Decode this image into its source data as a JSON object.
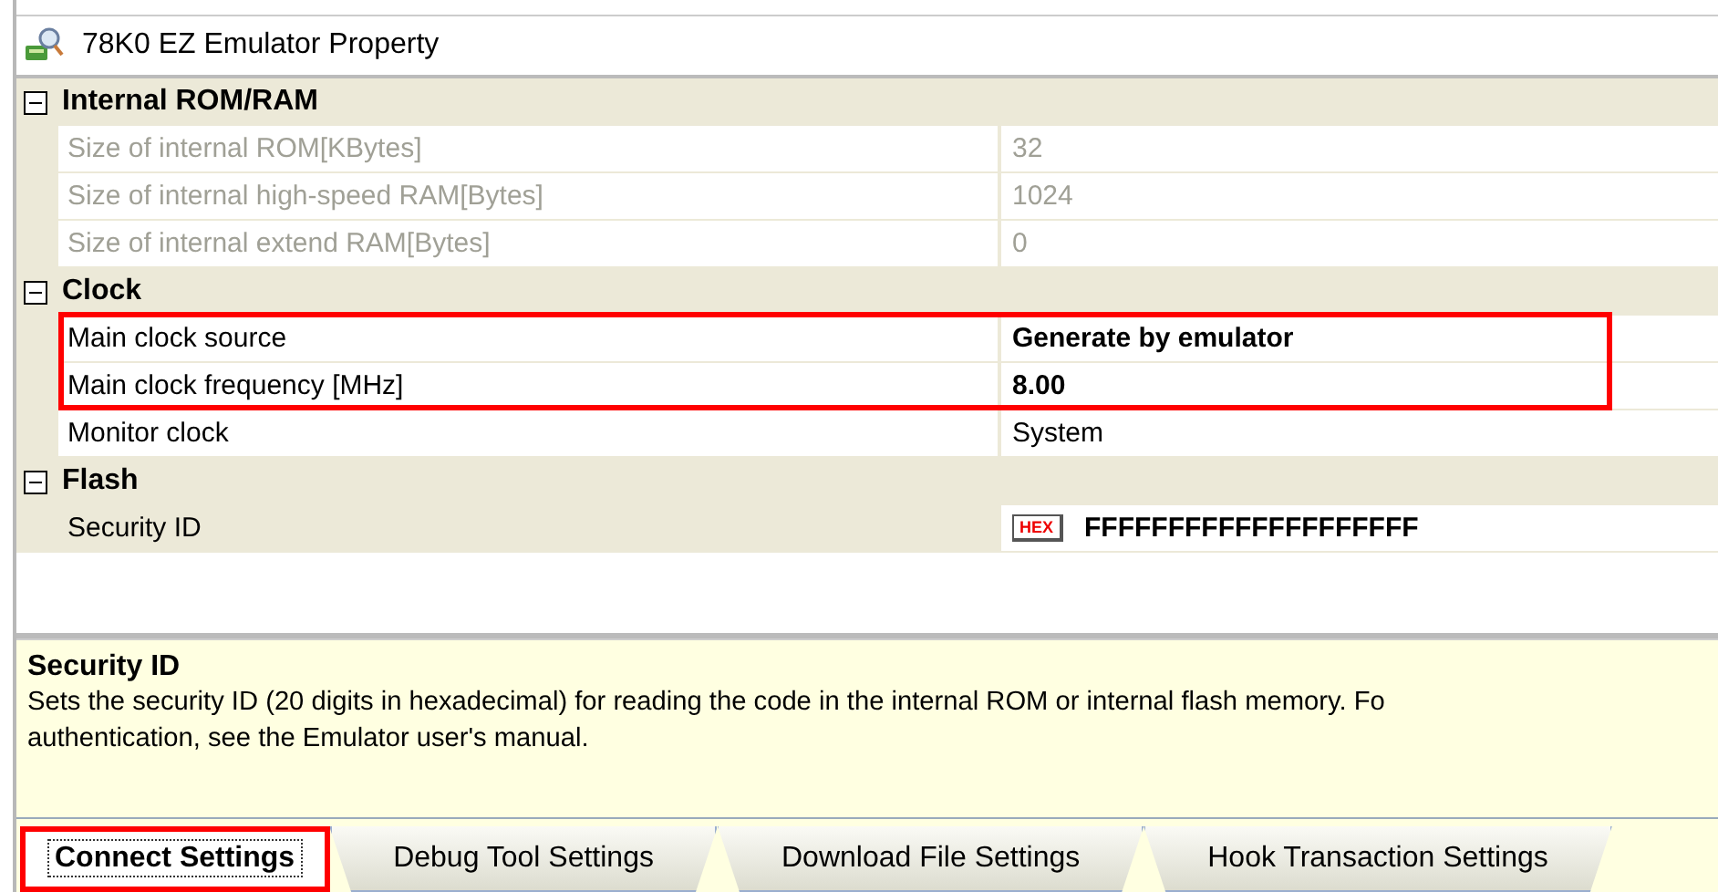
{
  "window": {
    "title": "78K0 EZ Emulator Property"
  },
  "categories": [
    {
      "label": "Internal ROM/RAM",
      "expanded": true,
      "properties": [
        {
          "name": "Size of internal ROM[KBytes]",
          "value": "32",
          "disabled": true,
          "modified": false,
          "highlighted": false
        },
        {
          "name": "Size of internal high-speed RAM[Bytes]",
          "value": "1024",
          "disabled": true,
          "modified": false,
          "highlighted": false
        },
        {
          "name": "Size of internal extend RAM[Bytes]",
          "value": "0",
          "disabled": true,
          "modified": false,
          "highlighted": false
        }
      ]
    },
    {
      "label": "Clock",
      "expanded": true,
      "properties": [
        {
          "name": "Main clock source",
          "value": "Generate by emulator",
          "disabled": false,
          "modified": true,
          "highlighted": true
        },
        {
          "name": "Main clock frequency [MHz]",
          "value": "8.00",
          "disabled": false,
          "modified": true,
          "highlighted": true
        },
        {
          "name": "Monitor clock",
          "value": "System",
          "disabled": false,
          "modified": false,
          "highlighted": false
        }
      ]
    },
    {
      "label": "Flash",
      "expanded": true,
      "properties": [
        {
          "name": "Security ID",
          "value": "FFFFFFFFFFFFFFFFFFFF",
          "kind": "hex",
          "badge": "HEX",
          "disabled": false,
          "modified": true,
          "highlighted": false,
          "selected": true
        }
      ]
    }
  ],
  "description": {
    "title": "Security ID",
    "lines": [
      "Sets the security ID (20 digits in hexadecimal) for reading the code in the internal ROM or internal flash memory. Fo",
      "authentication, see the Emulator user's manual."
    ]
  },
  "tabs": [
    {
      "label": "Connect Settings",
      "selected": true,
      "highlighted": true
    },
    {
      "label": "Debug Tool Settings",
      "selected": false,
      "highlighted": false
    },
    {
      "label": "Download File Settings",
      "selected": false,
      "highlighted": false
    },
    {
      "label": "Hook Transaction Settings",
      "selected": false,
      "highlighted": false
    }
  ]
}
